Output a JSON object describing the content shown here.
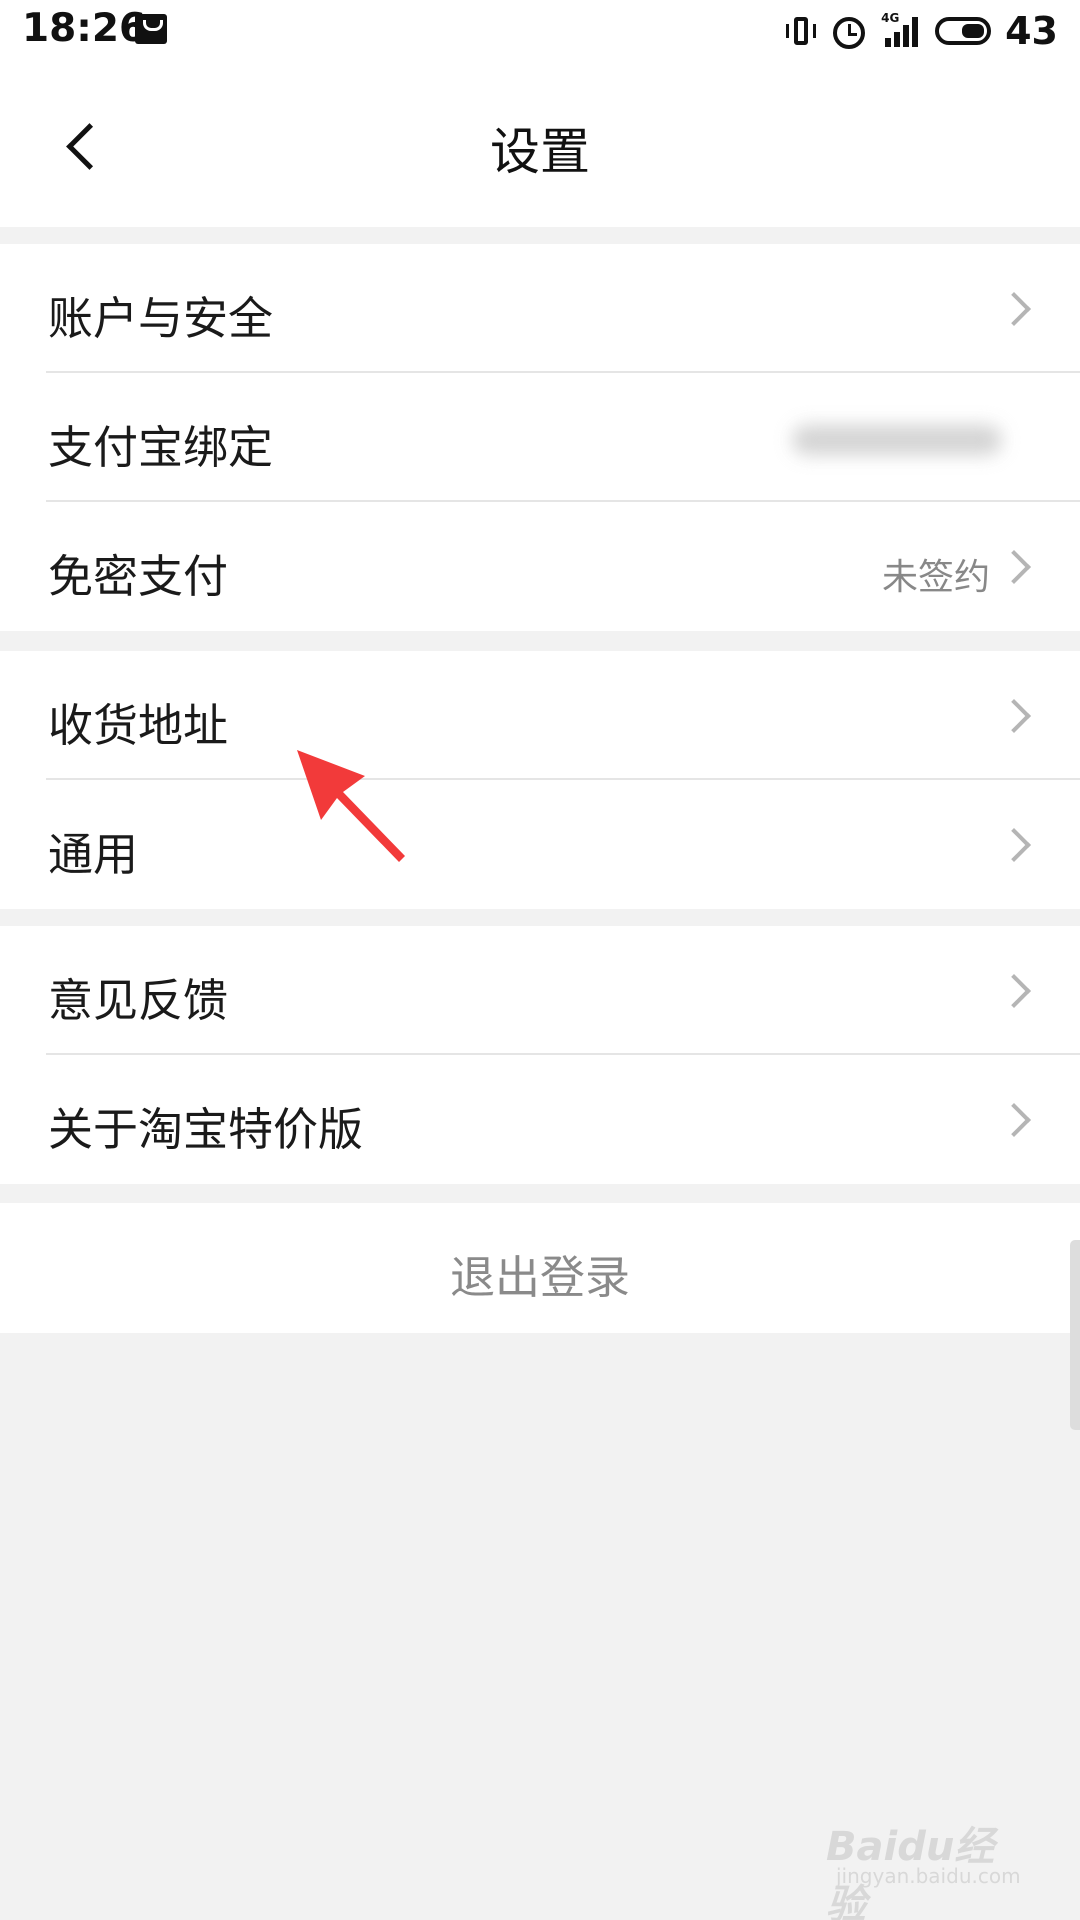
{
  "status_bar": {
    "time": "18:26",
    "network": "4G",
    "battery": "43"
  },
  "header": {
    "title": "设置"
  },
  "groups": [
    {
      "items": [
        {
          "label": "账户与安全",
          "value": ""
        },
        {
          "label": "支付宝绑定",
          "value": ""
        },
        {
          "label": "免密支付",
          "value": "未签约"
        }
      ]
    },
    {
      "items": [
        {
          "label": "收货地址",
          "value": ""
        },
        {
          "label": "通用",
          "value": ""
        }
      ]
    },
    {
      "items": [
        {
          "label": "意见反馈",
          "value": ""
        },
        {
          "label": "关于淘宝特价版",
          "value": ""
        }
      ]
    }
  ],
  "logout": {
    "label": "退出登录"
  },
  "watermark": {
    "main": "Baidu经验",
    "sub": "jingyan.baidu.com"
  },
  "colors": {
    "background": "#f2f2f2",
    "annotation_arrow": "#f23a3a",
    "chevron": "#b5b5b5",
    "secondary_text": "#888888"
  }
}
